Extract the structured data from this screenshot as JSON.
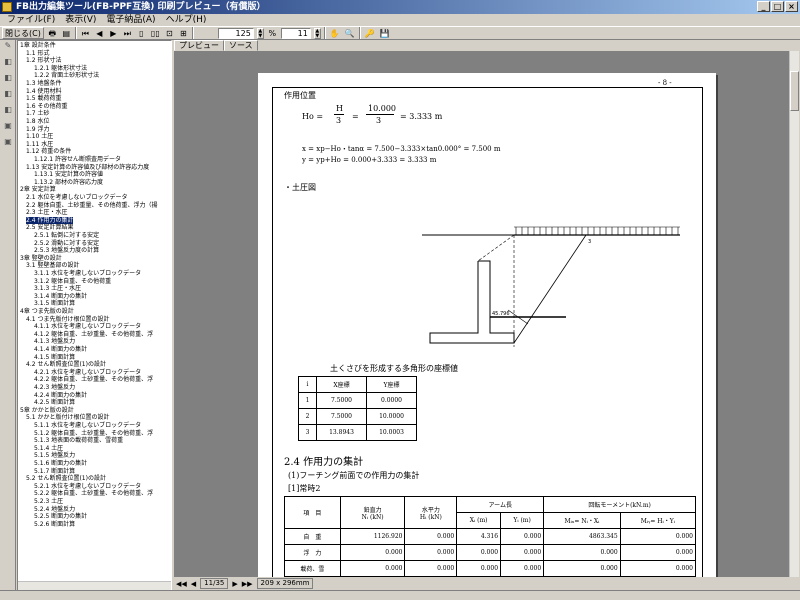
{
  "app": {
    "title": "FB出力編集ツール(FB-PPF互換) 印刷プレビュー（有償版）"
  },
  "window_controls": [
    "_",
    "□",
    "×"
  ],
  "menu": [
    "ファイル(F)",
    "表示(V)",
    "電子納品(A)",
    "ヘルプ(H)"
  ],
  "toolbar": {
    "close_label": "閉じる(C)",
    "zoom_value": "125",
    "page_value": "11"
  },
  "tree": {
    "items": [
      {
        "label": "1章 設計条件",
        "level": 0
      },
      {
        "label": "1.1 形式",
        "level": 1
      },
      {
        "label": "1.2 形状寸法",
        "level": 1
      },
      {
        "label": "1.2.1 躯体形状寸法",
        "level": 2
      },
      {
        "label": "1.2.2 背面土砂形状寸法",
        "level": 2
      },
      {
        "label": "1.3 地盤条件",
        "level": 1
      },
      {
        "label": "1.4 使用材料",
        "level": 1
      },
      {
        "label": "1.5 載荷荷重",
        "level": 1
      },
      {
        "label": "1.6 その他荷重",
        "level": 1
      },
      {
        "label": "1.7 土砂",
        "level": 1
      },
      {
        "label": "1.8 水位",
        "level": 1
      },
      {
        "label": "1.9 浮力",
        "level": 1
      },
      {
        "label": "1.10 土圧",
        "level": 1
      },
      {
        "label": "1.11 水圧",
        "level": 1
      },
      {
        "label": "1.12 荷重の条件",
        "level": 1
      },
      {
        "label": "1.12.1 許容せん断照査用データ",
        "level": 2
      },
      {
        "label": "1.13 安定計算の許容値及び部材の許容応力度",
        "level": 1
      },
      {
        "label": "1.13.1 安定計算の許容値",
        "level": 2
      },
      {
        "label": "1.13.2 部材の許容応力度",
        "level": 2
      },
      {
        "label": "2章 安定計算",
        "level": 0
      },
      {
        "label": "2.1 水位を考慮しないブロックデータ",
        "level": 1
      },
      {
        "label": "2.2 躯体自重、土砂重量、その他荷重、浮力（揚",
        "level": 1
      },
      {
        "label": "2.3 土圧・水圧",
        "level": 1
      },
      {
        "label": "2.4 作用力の集計",
        "level": 1,
        "selected": true
      },
      {
        "label": "2.5 安定計算結果",
        "level": 1
      },
      {
        "label": "2.5.1 転倒に対する安定",
        "level": 2
      },
      {
        "label": "2.5.2 滑動に対する安定",
        "level": 2
      },
      {
        "label": "2.5.3 地盤反力度の計算",
        "level": 2
      },
      {
        "label": "3章 竪壁の設計",
        "level": 0
      },
      {
        "label": "3.1 竪壁基部の設計",
        "level": 1
      },
      {
        "label": "3.1.1 水位を考慮しないブロックデータ",
        "level": 2
      },
      {
        "label": "3.1.2 躯体自重、その他荷重",
        "level": 2
      },
      {
        "label": "3.1.3 土圧・水圧",
        "level": 2
      },
      {
        "label": "3.1.4 断面力の集計",
        "level": 2
      },
      {
        "label": "3.1.5 断面計算",
        "level": 2
      },
      {
        "label": "4章 つま先版の設計",
        "level": 0
      },
      {
        "label": "4.1 つま先版付け根位置の設計",
        "level": 1
      },
      {
        "label": "4.1.1 水位を考慮しないブロックデータ",
        "level": 2
      },
      {
        "label": "4.1.2 躯体自重、土砂重量、その他荷重、浮",
        "level": 2
      },
      {
        "label": "4.1.3 地盤反力",
        "level": 2
      },
      {
        "label": "4.1.4 断面力の集計",
        "level": 2
      },
      {
        "label": "4.1.5 断面計算",
        "level": 2
      },
      {
        "label": "4.2 せん断照査位置(1)の設計",
        "level": 1
      },
      {
        "label": "4.2.1 水位を考慮しないブロックデータ",
        "level": 2
      },
      {
        "label": "4.2.2 躯体自重、土砂重量、その他荷重、浮",
        "level": 2
      },
      {
        "label": "4.2.3 地盤反力",
        "level": 2
      },
      {
        "label": "4.2.4 断面力の集計",
        "level": 2
      },
      {
        "label": "4.2.5 断面計算",
        "level": 2
      },
      {
        "label": "5章 かかと版の設計",
        "level": 0
      },
      {
        "label": "5.1 かかと版付け根位置の設計",
        "level": 1
      },
      {
        "label": "5.1.1 水位を考慮しないブロックデータ",
        "level": 2
      },
      {
        "label": "5.1.2 躯体自重、土砂重量、その他荷重、浮",
        "level": 2
      },
      {
        "label": "5.1.3 地表面の載荷荷重、雪荷重",
        "level": 2
      },
      {
        "label": "5.1.4 土圧",
        "level": 2
      },
      {
        "label": "5.1.5 地盤反力",
        "level": 2
      },
      {
        "label": "5.1.6 断面力の集計",
        "level": 2
      },
      {
        "label": "5.1.7 断面計算",
        "level": 2
      },
      {
        "label": "5.2 せん断照査位置(1)の設計",
        "level": 1
      },
      {
        "label": "5.2.1 水位を考慮しないブロックデータ",
        "level": 2
      },
      {
        "label": "5.2.2 躯体自重、土砂重量、その他荷重、浮",
        "level": 2
      },
      {
        "label": "5.2.3 土圧",
        "level": 2
      },
      {
        "label": "5.2.4 地盤反力",
        "level": 2
      },
      {
        "label": "5.2.5 断面力の集計",
        "level": 2
      },
      {
        "label": "5.2.6 断面計算",
        "level": 2
      }
    ]
  },
  "tabs": [
    "プレビュー",
    "ソース"
  ],
  "nav": {
    "page_info": "11/35",
    "paper_size": "209 x 296mm"
  },
  "page": {
    "page_number": "- 8 -",
    "section1": "作用位置",
    "eq1_lhs": "Ho =",
    "eq1_frac1_num": "H",
    "eq1_frac1_den": "3",
    "eq1_eq": "=",
    "eq1_frac2_num": "10.000",
    "eq1_frac2_den": "3",
    "eq1_result": "=  3.333  m",
    "eq2": "x  =  xp−Ho・tanα  =  7.500−3.333×tan0.000°  =  7.500  m",
    "eq3": "y  =  yp+Ho  =  0.000+3.333  =  3.333  m",
    "section2": "・土圧図",
    "diagram_label": "45.796",
    "diagram_pt3": "3",
    "diagram_pt1": "1",
    "coord_title": "土くさびを形成する多角形の座標値",
    "coord_headers": [
      "i",
      "X座標",
      "Y座標"
    ],
    "coord_rows": [
      [
        "1",
        "7.5000",
        "0.0000"
      ],
      [
        "2",
        "7.5000",
        "10.0000"
      ],
      [
        "3",
        "13.8943",
        "10.0003"
      ]
    ],
    "heading": "2.4 作用力の集計",
    "sub1": "(1)フーチング前面での作用力の集計",
    "sub2": "[1]常時2",
    "force_headers": {
      "item": "項　目",
      "vert": "鉛直力",
      "vert_unit": "Nᵢ (kN)",
      "horiz": "水平力",
      "horiz_unit": "Hᵢ (kN)",
      "arm": "アーム長",
      "arm_x": "Xᵢ (m)",
      "arm_y": "Yᵢ (m)",
      "moment": "回転モーメント(kN.m)",
      "moment_mx": "Mᵢₓ= Nᵢ・Xᵢ",
      "moment_my": "Mᵢᵧ= Hᵢ・Yᵢ"
    },
    "force_rows": [
      [
        "自　重",
        "1126.920",
        "0.000",
        "4.316",
        "0.000",
        "4863.345",
        "0.000"
      ],
      [
        "浮　力",
        "0.000",
        "0.000",
        "0.000",
        "0.000",
        "0.000",
        "0.000"
      ],
      [
        "載荷、雪",
        "0.000",
        "0.000",
        "0.000",
        "0.000",
        "0.000",
        "0.000"
      ],
      [
        "背面水圧",
        "0.000",
        "0.000",
        "0.000",
        "0.000",
        "0.000",
        "0.000"
      ],
      [
        "前面水圧",
        "0.000",
        "0.000",
        "0.000",
        "0.000",
        "0.000",
        "0.000"
      ]
    ]
  }
}
